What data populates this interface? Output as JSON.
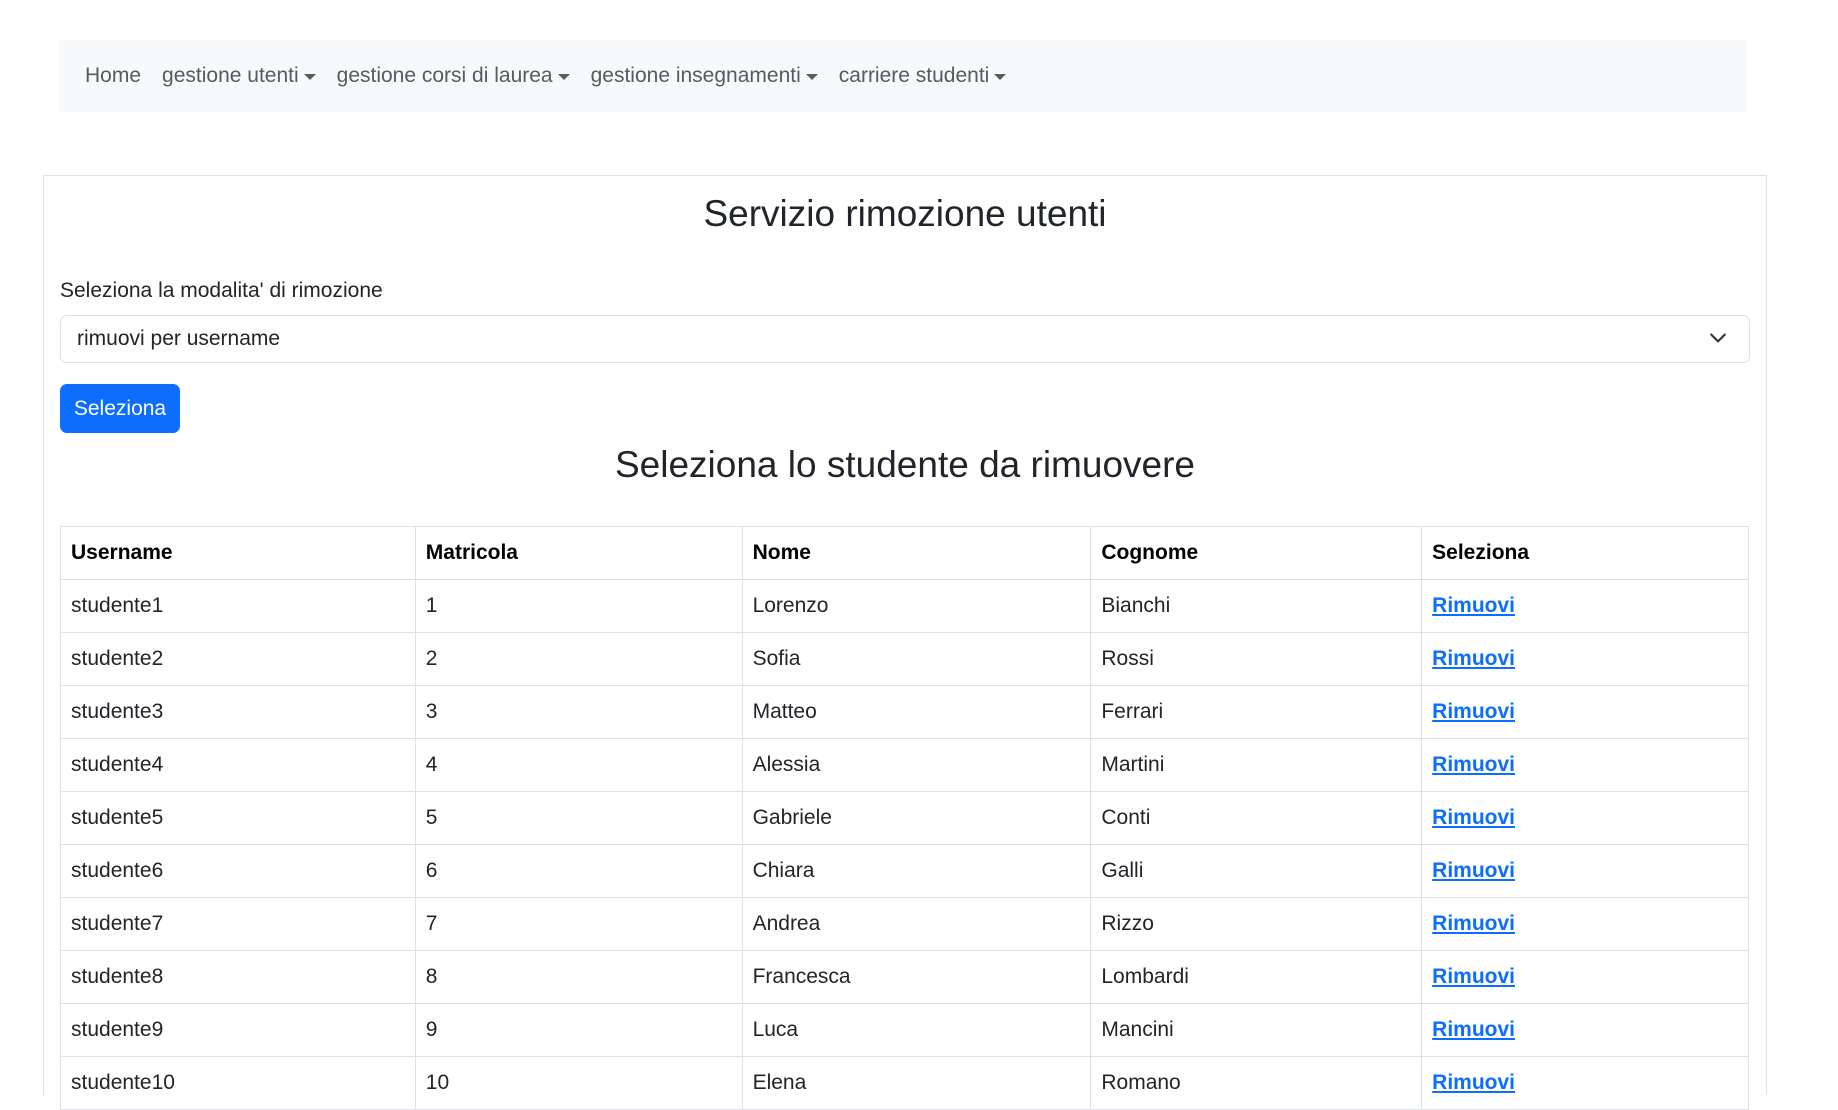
{
  "nav": {
    "home": "Home",
    "menus": [
      {
        "label": "gestione utenti"
      },
      {
        "label": "gestione corsi di laurea"
      },
      {
        "label": "gestione insegnamenti"
      },
      {
        "label": "carriere studenti"
      }
    ]
  },
  "main": {
    "title": "Servizio rimozione utenti",
    "mode_label": "Seleziona la modalita' di rimozione",
    "mode_selected": "rimuovi per username",
    "select_button": "Seleziona",
    "subtitle": "Seleziona lo studente da rimuovere"
  },
  "table": {
    "headers": [
      "Username",
      "Matricola",
      "Nome",
      "Cognome",
      "Seleziona"
    ],
    "rows": [
      {
        "username": "studente1",
        "matricola": "1",
        "nome": "Lorenzo",
        "cognome": "Bianchi",
        "action": "Rimuovi"
      },
      {
        "username": "studente2",
        "matricola": "2",
        "nome": "Sofia",
        "cognome": "Rossi",
        "action": "Rimuovi"
      },
      {
        "username": "studente3",
        "matricola": "3",
        "nome": "Matteo",
        "cognome": "Ferrari",
        "action": "Rimuovi"
      },
      {
        "username": "studente4",
        "matricola": "4",
        "nome": "Alessia",
        "cognome": "Martini",
        "action": "Rimuovi"
      },
      {
        "username": "studente5",
        "matricola": "5",
        "nome": "Gabriele",
        "cognome": "Conti",
        "action": "Rimuovi"
      },
      {
        "username": "studente6",
        "matricola": "6",
        "nome": "Chiara",
        "cognome": "Galli",
        "action": "Rimuovi"
      },
      {
        "username": "studente7",
        "matricola": "7",
        "nome": "Andrea",
        "cognome": "Rizzo",
        "action": "Rimuovi"
      },
      {
        "username": "studente8",
        "matricola": "8",
        "nome": "Francesca",
        "cognome": "Lombardi",
        "action": "Rimuovi"
      },
      {
        "username": "studente9",
        "matricola": "9",
        "nome": "Luca",
        "cognome": "Mancini",
        "action": "Rimuovi"
      },
      {
        "username": "studente10",
        "matricola": "10",
        "nome": "Elena",
        "cognome": "Romano",
        "action": "Rimuovi"
      }
    ]
  },
  "colors": {
    "primary": "#0d6efd",
    "navbar_bg": "#f8f9fa",
    "border": "#dee2e6"
  }
}
